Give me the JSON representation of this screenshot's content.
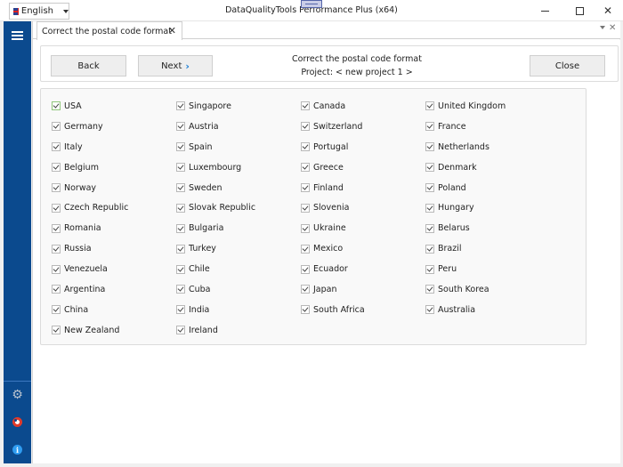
{
  "window": {
    "title": "DataQualityTools Performance Plus (x64)",
    "language": "English",
    "minimize_icon": "minimize-icon",
    "maximize_icon": "maximize-icon",
    "close_glyph": "✕"
  },
  "sidebar": {
    "menu_icon": "hamburger-icon",
    "bottom_icons": [
      "gear-icon",
      "lifebuoy-icon",
      "info-icon"
    ],
    "gear_glyph": "⚙",
    "info_glyph": "i"
  },
  "tabs": [
    {
      "label": "Correct the postal code format",
      "close_glyph": "✕",
      "active": true
    }
  ],
  "tabstrip": {
    "close_glyph": "✕"
  },
  "header": {
    "back_label": "Back",
    "next_label": "Next",
    "next_glyph": "›",
    "title": "Correct the postal code format",
    "project": "Project: < new project 1 >",
    "close_label": "Close"
  },
  "countries": [
    {
      "name": "USA",
      "checked": true,
      "focused": true
    },
    {
      "name": "Singapore",
      "checked": true
    },
    {
      "name": "Canada",
      "checked": true
    },
    {
      "name": "United Kingdom",
      "checked": true
    },
    {
      "name": "Germany",
      "checked": true
    },
    {
      "name": "Austria",
      "checked": true
    },
    {
      "name": "Switzerland",
      "checked": true
    },
    {
      "name": "France",
      "checked": true
    },
    {
      "name": "Italy",
      "checked": true
    },
    {
      "name": "Spain",
      "checked": true
    },
    {
      "name": "Portugal",
      "checked": true
    },
    {
      "name": "Netherlands",
      "checked": true
    },
    {
      "name": "Belgium",
      "checked": true
    },
    {
      "name": "Luxembourg",
      "checked": true
    },
    {
      "name": "Greece",
      "checked": true
    },
    {
      "name": "Denmark",
      "checked": true
    },
    {
      "name": "Norway",
      "checked": true
    },
    {
      "name": "Sweden",
      "checked": true
    },
    {
      "name": "Finland",
      "checked": true
    },
    {
      "name": "Poland",
      "checked": true
    },
    {
      "name": "Czech Republic",
      "checked": true
    },
    {
      "name": "Slovak Republic",
      "checked": true
    },
    {
      "name": "Slovenia",
      "checked": true
    },
    {
      "name": "Hungary",
      "checked": true
    },
    {
      "name": "Romania",
      "checked": true
    },
    {
      "name": "Bulgaria",
      "checked": true
    },
    {
      "name": "Ukraine",
      "checked": true
    },
    {
      "name": "Belarus",
      "checked": true
    },
    {
      "name": "Russia",
      "checked": true
    },
    {
      "name": "Turkey",
      "checked": true
    },
    {
      "name": "Mexico",
      "checked": true
    },
    {
      "name": "Brazil",
      "checked": true
    },
    {
      "name": "Venezuela",
      "checked": true
    },
    {
      "name": "Chile",
      "checked": true
    },
    {
      "name": "Ecuador",
      "checked": true
    },
    {
      "name": "Peru",
      "checked": true
    },
    {
      "name": "Argentina",
      "checked": true
    },
    {
      "name": "Cuba",
      "checked": true
    },
    {
      "name": "Japan",
      "checked": true
    },
    {
      "name": "South Korea",
      "checked": true
    },
    {
      "name": "China",
      "checked": true
    },
    {
      "name": "India",
      "checked": true
    },
    {
      "name": "South Africa",
      "checked": true
    },
    {
      "name": "Australia",
      "checked": true
    },
    {
      "name": "New Zealand",
      "checked": true
    },
    {
      "name": "Ireland",
      "checked": true
    }
  ],
  "colors": {
    "sidebar": "#0b4a8e",
    "accent": "#1b7fd6",
    "focus_border": "#8fc67a",
    "lifebuoy": "#e23a2a",
    "info": "#2f9cf0"
  }
}
